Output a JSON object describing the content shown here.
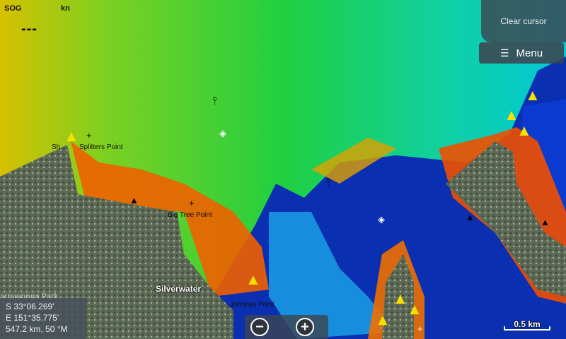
{
  "hud": {
    "sog_label": "SOG",
    "unit": "kn",
    "sog_value": "---"
  },
  "buttons": {
    "clear_cursor": "Clear cursor",
    "menu": "Menu",
    "zoom_out": "−",
    "zoom_in": "+"
  },
  "icons": {
    "menu": "hamburger-icon",
    "zoom_out": "minus-icon",
    "zoom_in": "plus-icon"
  },
  "cursor_info": {
    "lat": "S  33°06.269'",
    "lon": "E 151°35.775'",
    "range": "547.2 km, 50 °M"
  },
  "scale": {
    "label": "0.5 km"
  },
  "places": {
    "splitters": "Splitters Point",
    "splitters_prefix": "Sh",
    "big_tree": "Big Tree Point",
    "silverwater": "Silverwater",
    "johnnys": "Johnnys Point",
    "faded": "arrawonga Park"
  },
  "colors": {
    "deep": "#0a2fb0",
    "mid": "#00b8e0",
    "shallow": "#30d030",
    "shoal": "#f0d000",
    "edge": "#ff2000",
    "land": "#6a7560"
  }
}
